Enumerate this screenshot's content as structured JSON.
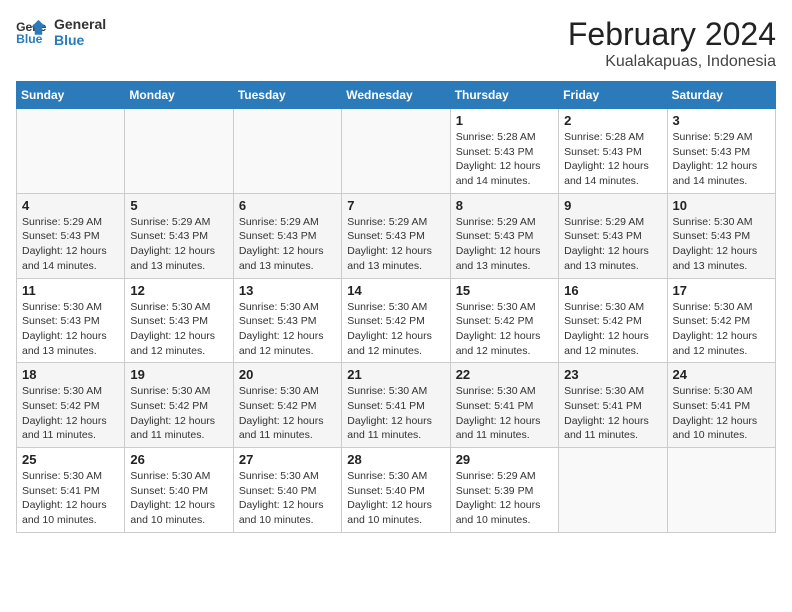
{
  "header": {
    "logo_line1": "General",
    "logo_line2": "Blue",
    "title": "February 2024",
    "subtitle": "Kualakapuas, Indonesia"
  },
  "days_of_week": [
    "Sunday",
    "Monday",
    "Tuesday",
    "Wednesday",
    "Thursday",
    "Friday",
    "Saturday"
  ],
  "weeks": [
    [
      {
        "day": "",
        "detail": ""
      },
      {
        "day": "",
        "detail": ""
      },
      {
        "day": "",
        "detail": ""
      },
      {
        "day": "",
        "detail": ""
      },
      {
        "day": "1",
        "detail": "Sunrise: 5:28 AM\nSunset: 5:43 PM\nDaylight: 12 hours\nand 14 minutes."
      },
      {
        "day": "2",
        "detail": "Sunrise: 5:28 AM\nSunset: 5:43 PM\nDaylight: 12 hours\nand 14 minutes."
      },
      {
        "day": "3",
        "detail": "Sunrise: 5:29 AM\nSunset: 5:43 PM\nDaylight: 12 hours\nand 14 minutes."
      }
    ],
    [
      {
        "day": "4",
        "detail": "Sunrise: 5:29 AM\nSunset: 5:43 PM\nDaylight: 12 hours\nand 14 minutes."
      },
      {
        "day": "5",
        "detail": "Sunrise: 5:29 AM\nSunset: 5:43 PM\nDaylight: 12 hours\nand 13 minutes."
      },
      {
        "day": "6",
        "detail": "Sunrise: 5:29 AM\nSunset: 5:43 PM\nDaylight: 12 hours\nand 13 minutes."
      },
      {
        "day": "7",
        "detail": "Sunrise: 5:29 AM\nSunset: 5:43 PM\nDaylight: 12 hours\nand 13 minutes."
      },
      {
        "day": "8",
        "detail": "Sunrise: 5:29 AM\nSunset: 5:43 PM\nDaylight: 12 hours\nand 13 minutes."
      },
      {
        "day": "9",
        "detail": "Sunrise: 5:29 AM\nSunset: 5:43 PM\nDaylight: 12 hours\nand 13 minutes."
      },
      {
        "day": "10",
        "detail": "Sunrise: 5:30 AM\nSunset: 5:43 PM\nDaylight: 12 hours\nand 13 minutes."
      }
    ],
    [
      {
        "day": "11",
        "detail": "Sunrise: 5:30 AM\nSunset: 5:43 PM\nDaylight: 12 hours\nand 13 minutes."
      },
      {
        "day": "12",
        "detail": "Sunrise: 5:30 AM\nSunset: 5:43 PM\nDaylight: 12 hours\nand 12 minutes."
      },
      {
        "day": "13",
        "detail": "Sunrise: 5:30 AM\nSunset: 5:43 PM\nDaylight: 12 hours\nand 12 minutes."
      },
      {
        "day": "14",
        "detail": "Sunrise: 5:30 AM\nSunset: 5:42 PM\nDaylight: 12 hours\nand 12 minutes."
      },
      {
        "day": "15",
        "detail": "Sunrise: 5:30 AM\nSunset: 5:42 PM\nDaylight: 12 hours\nand 12 minutes."
      },
      {
        "day": "16",
        "detail": "Sunrise: 5:30 AM\nSunset: 5:42 PM\nDaylight: 12 hours\nand 12 minutes."
      },
      {
        "day": "17",
        "detail": "Sunrise: 5:30 AM\nSunset: 5:42 PM\nDaylight: 12 hours\nand 12 minutes."
      }
    ],
    [
      {
        "day": "18",
        "detail": "Sunrise: 5:30 AM\nSunset: 5:42 PM\nDaylight: 12 hours\nand 11 minutes."
      },
      {
        "day": "19",
        "detail": "Sunrise: 5:30 AM\nSunset: 5:42 PM\nDaylight: 12 hours\nand 11 minutes."
      },
      {
        "day": "20",
        "detail": "Sunrise: 5:30 AM\nSunset: 5:42 PM\nDaylight: 12 hours\nand 11 minutes."
      },
      {
        "day": "21",
        "detail": "Sunrise: 5:30 AM\nSunset: 5:41 PM\nDaylight: 12 hours\nand 11 minutes."
      },
      {
        "day": "22",
        "detail": "Sunrise: 5:30 AM\nSunset: 5:41 PM\nDaylight: 12 hours\nand 11 minutes."
      },
      {
        "day": "23",
        "detail": "Sunrise: 5:30 AM\nSunset: 5:41 PM\nDaylight: 12 hours\nand 11 minutes."
      },
      {
        "day": "24",
        "detail": "Sunrise: 5:30 AM\nSunset: 5:41 PM\nDaylight: 12 hours\nand 10 minutes."
      }
    ],
    [
      {
        "day": "25",
        "detail": "Sunrise: 5:30 AM\nSunset: 5:41 PM\nDaylight: 12 hours\nand 10 minutes."
      },
      {
        "day": "26",
        "detail": "Sunrise: 5:30 AM\nSunset: 5:40 PM\nDaylight: 12 hours\nand 10 minutes."
      },
      {
        "day": "27",
        "detail": "Sunrise: 5:30 AM\nSunset: 5:40 PM\nDaylight: 12 hours\nand 10 minutes."
      },
      {
        "day": "28",
        "detail": "Sunrise: 5:30 AM\nSunset: 5:40 PM\nDaylight: 12 hours\nand 10 minutes."
      },
      {
        "day": "29",
        "detail": "Sunrise: 5:29 AM\nSunset: 5:39 PM\nDaylight: 12 hours\nand 10 minutes."
      },
      {
        "day": "",
        "detail": ""
      },
      {
        "day": "",
        "detail": ""
      }
    ]
  ]
}
